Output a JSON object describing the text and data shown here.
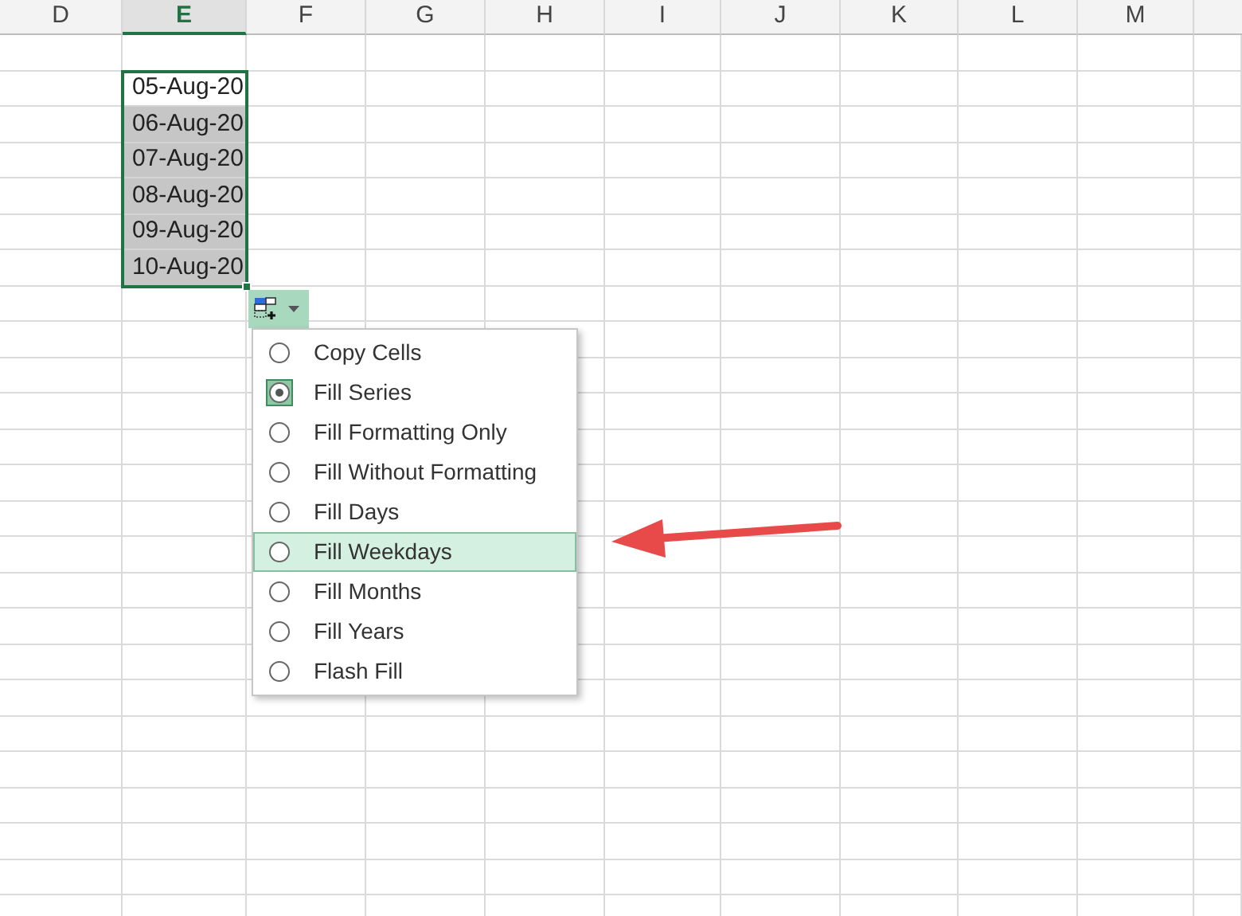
{
  "column_headers": [
    {
      "label": "D",
      "selected": false
    },
    {
      "label": "E",
      "selected": true
    },
    {
      "label": "F",
      "selected": false
    },
    {
      "label": "G",
      "selected": false
    },
    {
      "label": "H",
      "selected": false
    },
    {
      "label": "I",
      "selected": false
    },
    {
      "label": "J",
      "selected": false
    },
    {
      "label": "K",
      "selected": false
    },
    {
      "label": "L",
      "selected": false
    },
    {
      "label": "M",
      "selected": false
    }
  ],
  "filled_cells": [
    {
      "value": "05-Aug-20",
      "active": true
    },
    {
      "value": "06-Aug-20",
      "active": false
    },
    {
      "value": "07-Aug-20",
      "active": false
    },
    {
      "value": "08-Aug-20",
      "active": false
    },
    {
      "value": "09-Aug-20",
      "active": false
    },
    {
      "value": "10-Aug-20",
      "active": false
    }
  ],
  "autofill_menu": [
    {
      "label": "Copy Cells",
      "selected": false,
      "highlighted": false
    },
    {
      "label": "Fill Series",
      "selected": true,
      "highlighted": false
    },
    {
      "label": "Fill Formatting Only",
      "selected": false,
      "highlighted": false
    },
    {
      "label": "Fill Without Formatting",
      "selected": false,
      "highlighted": false
    },
    {
      "label": "Fill Days",
      "selected": false,
      "highlighted": false
    },
    {
      "label": "Fill Weekdays",
      "selected": false,
      "highlighted": true
    },
    {
      "label": "Fill Months",
      "selected": false,
      "highlighted": false
    },
    {
      "label": "Fill Years",
      "selected": false,
      "highlighted": false
    },
    {
      "label": "Flash Fill",
      "selected": false,
      "highlighted": false
    }
  ]
}
